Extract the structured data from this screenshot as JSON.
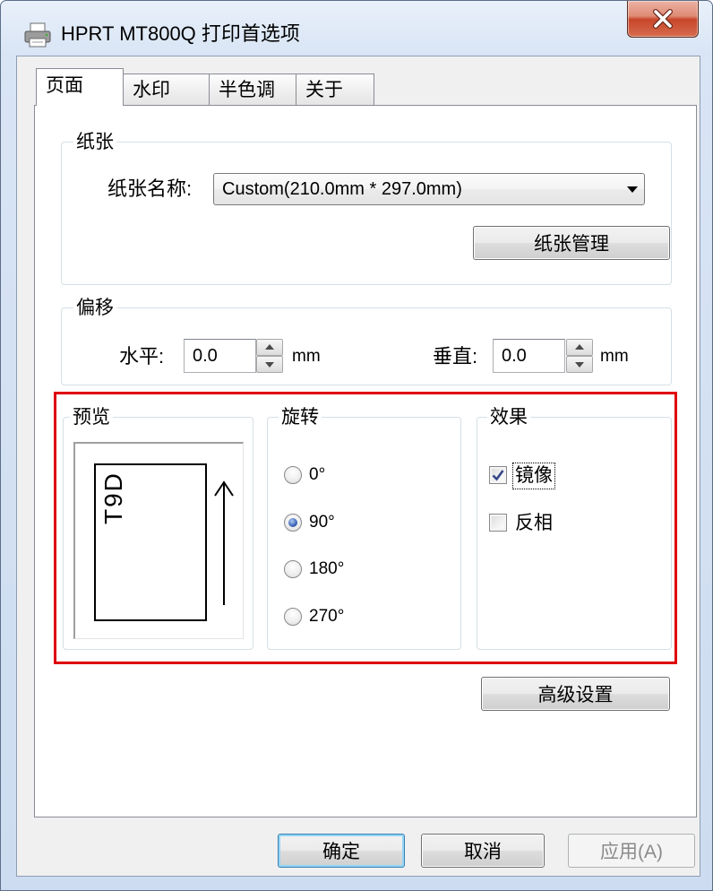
{
  "window": {
    "title": "HPRT MT800Q 打印首选项"
  },
  "tabs": [
    {
      "label": "页面",
      "selected": true
    },
    {
      "label": "水印",
      "selected": false
    },
    {
      "label": "半色调",
      "selected": false
    },
    {
      "label": "关于",
      "selected": false
    }
  ],
  "paper": {
    "group_label": "纸张",
    "name_label": "纸张名称:",
    "name_value": "Custom(210.0mm * 297.0mm)",
    "manage_button": "纸张管理"
  },
  "offset": {
    "group_label": "偏移",
    "horizontal_label": "水平:",
    "horizontal_value": "0.0",
    "horizontal_unit": "mm",
    "vertical_label": "垂直:",
    "vertical_value": "0.0",
    "vertical_unit": "mm"
  },
  "preview": {
    "group_label": "预览",
    "sample_text": "T9D"
  },
  "rotation": {
    "group_label": "旋转",
    "options": [
      {
        "label": "0°",
        "checked": false
      },
      {
        "label": "90°",
        "checked": true
      },
      {
        "label": "180°",
        "checked": false
      },
      {
        "label": "270°",
        "checked": false
      }
    ]
  },
  "effects": {
    "group_label": "效果",
    "mirror": {
      "label": "镜像",
      "checked": true,
      "focused": true
    },
    "invert": {
      "label": "反相",
      "checked": false,
      "focused": false
    }
  },
  "advanced_button": "高级设置",
  "footer": {
    "ok_button": "确定",
    "cancel_button": "取消",
    "apply_button": "应用(A)",
    "apply_disabled": true
  },
  "icons": {
    "title": "printer-icon",
    "close": "close-icon",
    "combo": "chevron-down-icon",
    "spin_up": "spin-up-icon",
    "spin_down": "spin-down-icon",
    "preview_direction": "arrow-up-icon",
    "check": "checkmark-icon"
  },
  "colors": {
    "highlight_box": "#e00000",
    "client_background": "#f0f0f0",
    "panel_background": "#ffffff",
    "default_button_border": "#3c7fb1",
    "close_button": "#c8462a"
  }
}
